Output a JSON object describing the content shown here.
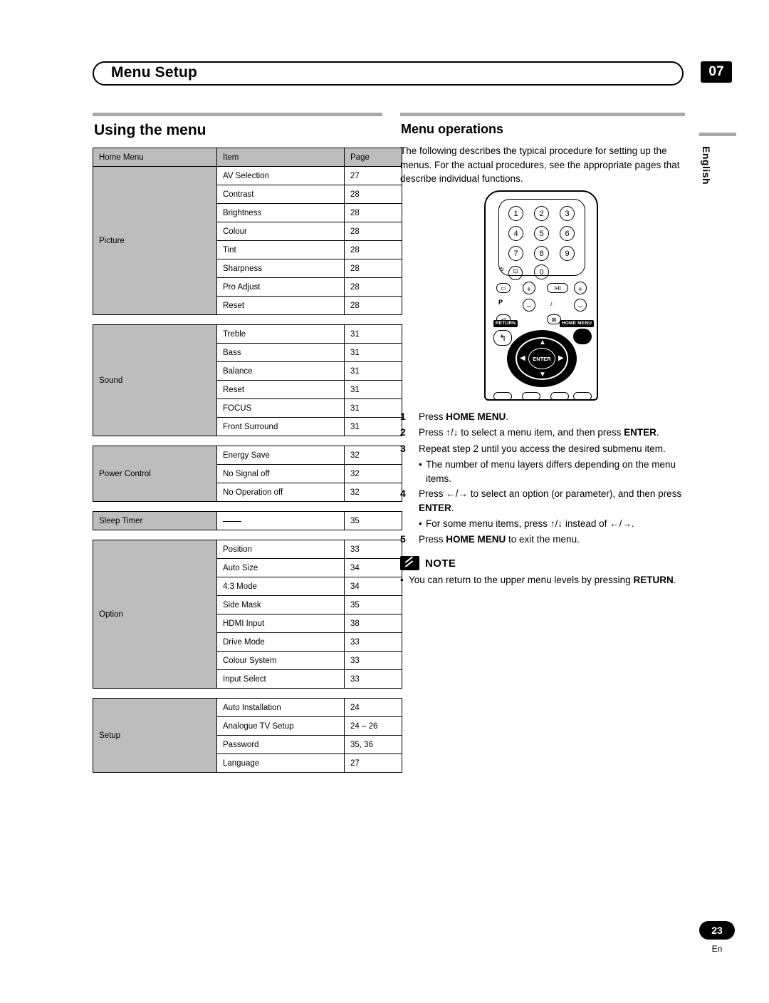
{
  "header": {
    "title": "Menu Setup",
    "chapter": "07"
  },
  "left": {
    "section_title": "Using the menu",
    "table": {
      "headers": [
        "Home Menu",
        "Item",
        "Page"
      ],
      "groups": [
        {
          "name": "Picture",
          "rows": [
            {
              "item": "AV Selection",
              "page": "27"
            },
            {
              "item": "Contrast",
              "page": "28"
            },
            {
              "item": "Brightness",
              "page": "28"
            },
            {
              "item": "Colour",
              "page": "28"
            },
            {
              "item": "Tint",
              "page": "28"
            },
            {
              "item": "Sharpness",
              "page": "28"
            },
            {
              "item": "Pro Adjust",
              "page": "28"
            },
            {
              "item": "Reset",
              "page": "28"
            }
          ]
        },
        {
          "name": "Sound",
          "rows": [
            {
              "item": "Treble",
              "page": "31"
            },
            {
              "item": "Bass",
              "page": "31"
            },
            {
              "item": "Balance",
              "page": "31"
            },
            {
              "item": "Reset",
              "page": "31"
            },
            {
              "item": "FOCUS",
              "page": "31"
            },
            {
              "item": "Front Surround",
              "page": "31"
            }
          ]
        },
        {
          "name": "Power Control",
          "rows": [
            {
              "item": "Energy Save",
              "page": "32"
            },
            {
              "item": "No Signal off",
              "page": "32"
            },
            {
              "item": "No Operation off",
              "page": "32"
            }
          ]
        },
        {
          "name": "Sleep Timer",
          "rows": [
            {
              "item": "",
              "page": "35",
              "dash": true
            }
          ]
        },
        {
          "name": "Option",
          "rows": [
            {
              "item": "Position",
              "page": "33"
            },
            {
              "item": "Auto Size",
              "page": "34"
            },
            {
              "item": "4:3 Mode",
              "page": "34"
            },
            {
              "item": "Side Mask",
              "page": "35"
            },
            {
              "item": "HDMI Input",
              "page": "38"
            },
            {
              "item": "Drive Mode",
              "page": "33"
            },
            {
              "item": "Colour System",
              "page": "33"
            },
            {
              "item": "Input Select",
              "page": "33"
            }
          ]
        },
        {
          "name": "Setup",
          "rows": [
            {
              "item": "Auto Installation",
              "page": "24"
            },
            {
              "item": "Analogue TV Setup",
              "page": "24 – 26"
            },
            {
              "item": "Password",
              "page": "35, 36"
            },
            {
              "item": "Language",
              "page": "27"
            }
          ]
        }
      ]
    }
  },
  "right": {
    "title": "Menu operations",
    "intro": "The following describes the typical procedure for setting up the menus. For the actual procedures, see the appropriate pages that describe individual functions.",
    "remote": {
      "numbers": [
        "1",
        "2",
        "3",
        "4",
        "5",
        "6",
        "7",
        "8",
        "9",
        "0"
      ],
      "sub_buttons": [
        "P",
        "RETURN",
        "HOME MENU",
        "ENTER"
      ],
      "icons": [
        "power-icon",
        "input-icon",
        "volume-icon",
        "mute-icon",
        "sound-mode-icon",
        "channel-icon"
      ]
    },
    "steps": [
      {
        "num": "1",
        "text_parts": [
          {
            "t": "Press ",
            "b": false
          },
          {
            "t": "HOME MENU",
            "b": true
          },
          {
            "t": ".",
            "b": false
          }
        ]
      },
      {
        "num": "2",
        "text_parts": [
          {
            "t": "Press ",
            "b": false
          },
          {
            "t": "↑/↓",
            "b": false
          },
          {
            "t": " to select a menu item, and then press ",
            "b": false
          },
          {
            "t": "ENTER",
            "b": true
          },
          {
            "t": ".",
            "b": false
          }
        ]
      },
      {
        "num": "3",
        "text_parts": [
          {
            "t": "Repeat step 2 until you access the desired submenu item.",
            "b": false
          }
        ]
      },
      {
        "num": "",
        "bullet": true,
        "text_parts": [
          {
            "t": "The number of menu layers differs depending on the menu items.",
            "b": false
          }
        ]
      },
      {
        "num": "4",
        "text_parts": [
          {
            "t": "Press ",
            "b": false
          },
          {
            "t": "←/→",
            "b": false
          },
          {
            "t": " to select an option (or parameter), and then press ",
            "b": false
          },
          {
            "t": "ENTER",
            "b": true
          },
          {
            "t": ".",
            "b": false
          }
        ]
      },
      {
        "num": "",
        "bullet": true,
        "text_parts": [
          {
            "t": "For some menu items, press ",
            "b": false
          },
          {
            "t": "↑/↓",
            "b": false
          },
          {
            "t": " instead of ",
            "b": false
          },
          {
            "t": "←/→",
            "b": false
          },
          {
            "t": ".",
            "b": false
          }
        ]
      },
      {
        "num": "5",
        "text_parts": [
          {
            "t": "Press ",
            "b": false
          },
          {
            "t": "HOME MENU",
            "b": true
          },
          {
            "t": " to exit the menu.",
            "b": false
          }
        ]
      }
    ],
    "note": {
      "title": "NOTE",
      "body_parts": [
        {
          "t": "You can return to the upper menu levels by pressing ",
          "b": false
        },
        {
          "t": "RETURN",
          "b": true
        },
        {
          "t": ".",
          "b": false
        }
      ]
    }
  },
  "side": {
    "language": "English"
  },
  "footer": {
    "page": "23",
    "lang": "En"
  }
}
